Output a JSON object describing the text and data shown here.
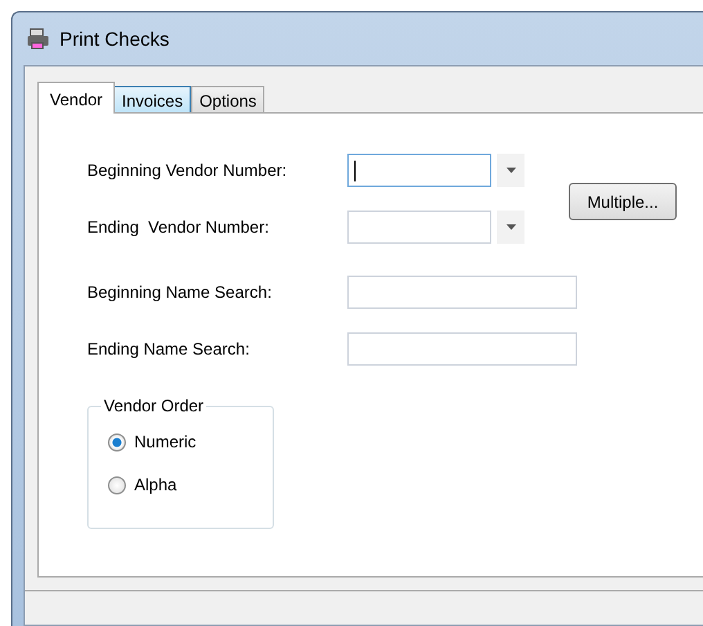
{
  "window": {
    "title": "Print Checks"
  },
  "tabs": [
    {
      "label": "Vendor",
      "selected": true
    },
    {
      "label": "Invoices",
      "selected": false
    },
    {
      "label": "Options",
      "selected": false
    }
  ],
  "fields": [
    {
      "label": "Beginning Vendor Number:",
      "kind": "combo",
      "focused": true
    },
    {
      "label": "Ending  Vendor Number:",
      "kind": "combo",
      "focused": false
    },
    {
      "label": "Beginning Name Search:",
      "kind": "text",
      "focused": false
    },
    {
      "label": "Ending Name Search:",
      "kind": "text",
      "focused": false
    }
  ],
  "multiple_button": "Multiple...",
  "vendor_order": {
    "title": "Vendor Order",
    "options": [
      {
        "label": "Numeric",
        "selected": true
      },
      {
        "label": "Alpha",
        "selected": false
      }
    ]
  }
}
